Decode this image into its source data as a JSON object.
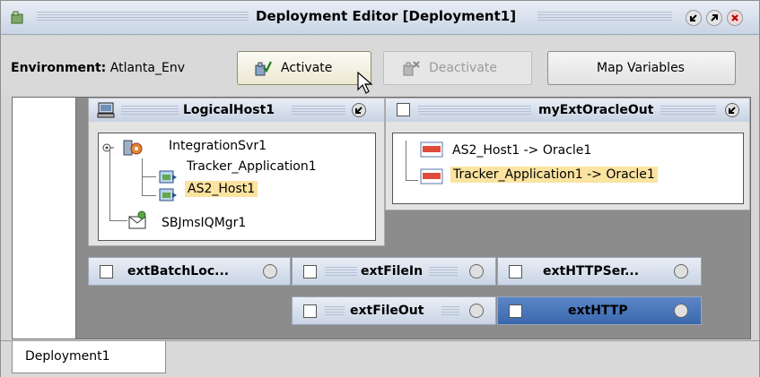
{
  "window": {
    "title": "Deployment Editor [Deployment1]",
    "icons": [
      "app-icon",
      "collapse-icon",
      "maximize-icon",
      "close-icon"
    ]
  },
  "toolbar": {
    "env_label": "Environment:",
    "env_value": "Atlanta_Env",
    "activate_label": "Activate",
    "deactivate_label": "Deactivate",
    "map_variables_label": "Map Variables"
  },
  "logical_host": {
    "title": "LogicalHost1",
    "tree": {
      "server": "IntegrationSvr1",
      "children": [
        "Tracker_Application1",
        "AS2_Host1"
      ],
      "jms": "SBJmsIQMgr1"
    }
  },
  "external": {
    "title": "myExtOracleOut",
    "items": [
      "AS2_Host1 -> Oracle1",
      "Tracker_Application1 -> Oracle1"
    ]
  },
  "external_systems": [
    "extBatchLoc...",
    "extFileIn",
    "extHTTPSer...",
    "extFileOut",
    "extHTTP"
  ],
  "tabs": [
    "Deployment1"
  ],
  "colors": {
    "selection": "#fbe3a0",
    "dark_header": "#3b67ad",
    "panel_area": "#8c8c8c"
  }
}
